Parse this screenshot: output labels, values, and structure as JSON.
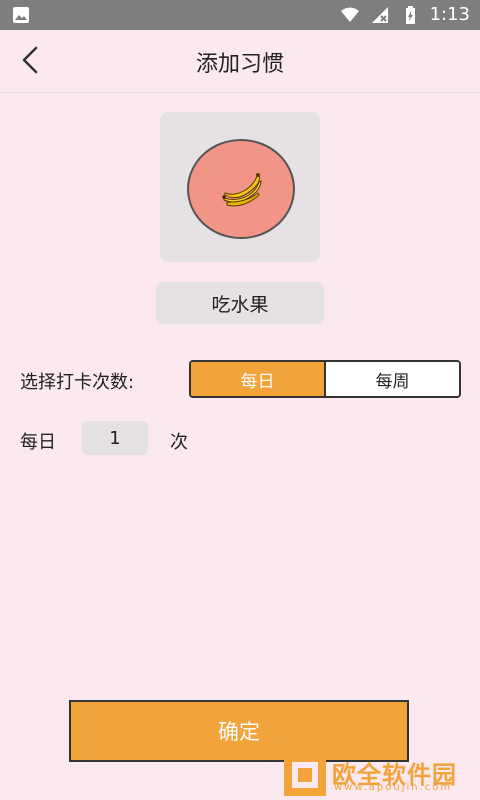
{
  "status_bar": {
    "time": "1:13",
    "left_icon": "image-icon",
    "icons": [
      "wifi-icon",
      "signal-off-icon",
      "battery-icon"
    ]
  },
  "app_bar": {
    "title": "添加习惯",
    "back_icon": "back-arrow-icon"
  },
  "habit": {
    "icon_name": "banana-icon",
    "name": "吃水果"
  },
  "frequency": {
    "label": "选择打卡次数:",
    "options": [
      "每日",
      "每周"
    ],
    "selected": "每日"
  },
  "count_row": {
    "prefix": "每日",
    "value": "1",
    "suffix": "次"
  },
  "confirm_button": {
    "label": "确定"
  },
  "watermark": {
    "text": "欧全软件园",
    "sub": "www.apoujin.com"
  },
  "colors": {
    "background": "#fbe9ef",
    "accent": "#f2a33a",
    "plate": "#f29486",
    "status_bar": "#7e7e7e"
  }
}
